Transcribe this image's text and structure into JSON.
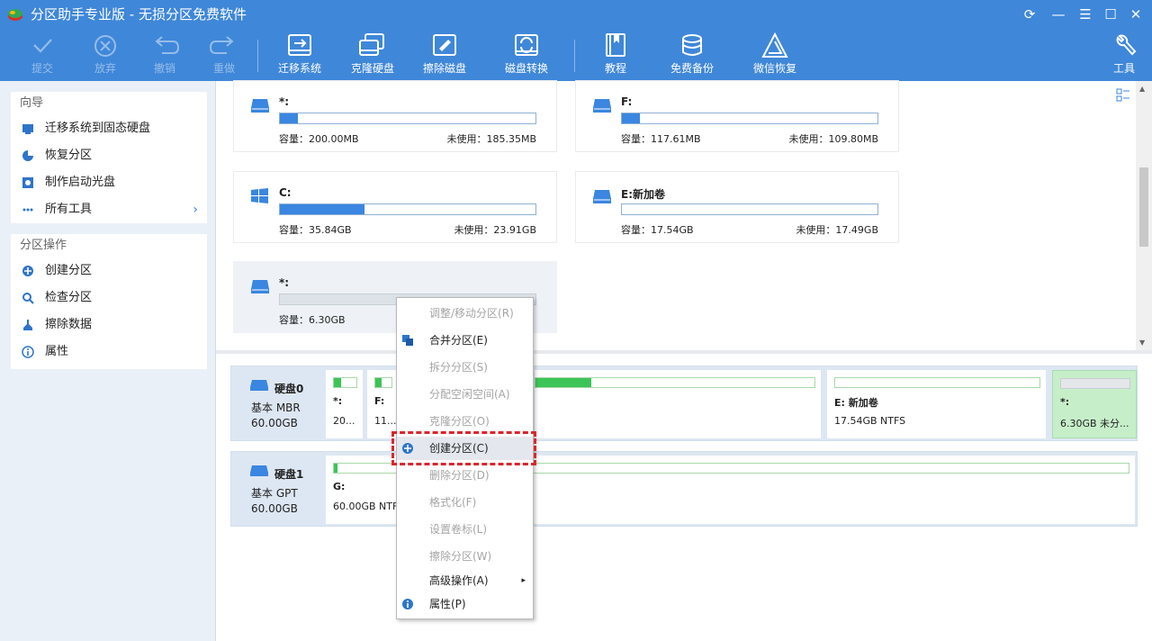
{
  "window": {
    "title": "分区助手专业版 - 无损分区免费软件",
    "controls": [
      "refresh-icon",
      "minimize-icon",
      "menu-icon",
      "maximize-icon",
      "close-icon"
    ]
  },
  "toolbar": {
    "buttons": [
      {
        "label": "提交",
        "icon": "check-icon",
        "enabled": false
      },
      {
        "label": "放弃",
        "icon": "cancel-icon",
        "enabled": false
      },
      {
        "label": "撤销",
        "icon": "undo-icon",
        "enabled": false
      },
      {
        "label": "重做",
        "icon": "redo-icon",
        "enabled": false
      },
      {
        "label": "迁移系统",
        "icon": "migrate-os-icon",
        "enabled": true
      },
      {
        "label": "克隆硬盘",
        "icon": "clone-disk-icon",
        "enabled": true
      },
      {
        "label": "擦除磁盘",
        "icon": "wipe-disk-icon",
        "enabled": true
      },
      {
        "label": "磁盘转换",
        "icon": "convert-disk-icon",
        "enabled": true
      },
      {
        "label": "教程",
        "icon": "tutorial-book-icon",
        "enabled": true
      },
      {
        "label": "免费备份",
        "icon": "backup-icon",
        "enabled": true
      },
      {
        "label": "微信恢复",
        "icon": "recovery-icon",
        "enabled": true
      },
      {
        "label": "工具",
        "icon": "tools-wrench-icon",
        "enabled": true
      }
    ]
  },
  "sidebar": {
    "wizard": {
      "title": "向导",
      "items": [
        {
          "label": "迁移系统到固态硬盘",
          "icon": "migrate-ssd-icon"
        },
        {
          "label": "恢复分区",
          "icon": "recover-partition-icon"
        },
        {
          "label": "制作启动光盘",
          "icon": "boot-disc-icon"
        },
        {
          "label": "所有工具",
          "icon": "all-tools-icon",
          "chevron": "›"
        }
      ]
    },
    "operations": {
      "title": "分区操作",
      "items": [
        {
          "label": "创建分区",
          "icon": "create-partition-icon"
        },
        {
          "label": "检查分区",
          "icon": "check-partition-icon"
        },
        {
          "label": "擦除数据",
          "icon": "wipe-data-icon"
        },
        {
          "label": "属性",
          "icon": "info-icon"
        }
      ]
    }
  },
  "partitions": [
    {
      "name": "*:",
      "capacity": "容量：200.00MB",
      "free": "未使用：185.35MB",
      "used_fraction": 0.07,
      "icon": "drive-icon"
    },
    {
      "name": "F:",
      "capacity": "容量：117.61MB",
      "free": "未使用：109.80MB",
      "used_fraction": 0.07,
      "icon": "drive-icon"
    },
    {
      "name": "C:",
      "capacity": "容量：35.84GB",
      "free": "未使用：23.91GB",
      "used_fraction": 0.33,
      "icon": "windows-icon"
    },
    {
      "name": "E:新加卷",
      "capacity": "容量：17.54GB",
      "free": "未使用：17.49GB",
      "used_fraction": 0.0,
      "icon": "drive-icon"
    },
    {
      "name": "*:",
      "capacity": "容量：6.30GB",
      "free": "",
      "used_fraction": 0,
      "icon": "drive-icon",
      "unallocated": true
    }
  ],
  "disks": [
    {
      "name": "硬盘0",
      "type": "基本 MBR",
      "size": "60.00GB",
      "parts": [
        {
          "name": "*:",
          "size": "20...",
          "used_fraction": 0.3
        },
        {
          "name": "F:",
          "size": "11...",
          "used_fraction": 0.4
        },
        {
          "name": "",
          "size": "",
          "used_fraction": 0.2
        },
        {
          "name": "E: 新加卷",
          "size": "17.54GB NTFS",
          "used_fraction": 0.0
        },
        {
          "name": "*:",
          "size": "6.30GB 未分...",
          "used_fraction": 0,
          "unallocated": true
        }
      ]
    },
    {
      "name": "硬盘1",
      "type": "基本 GPT",
      "size": "60.00GB",
      "parts": [
        {
          "name": "G:",
          "size": "60.00GB NTFS",
          "used_fraction": 0.005
        }
      ]
    }
  ],
  "context_menu": {
    "items": [
      {
        "label": "调整/移动分区(R)",
        "enabled": false
      },
      {
        "label": "合并分区(E)",
        "enabled": true,
        "icon": "merge-icon"
      },
      {
        "label": "拆分分区(S)",
        "enabled": false
      },
      {
        "label": "分配空闲空间(A)",
        "enabled": false
      },
      {
        "label": "克隆分区(O)",
        "enabled": false
      },
      {
        "label": "创建分区(C)",
        "enabled": true,
        "icon": "create-partition-icon",
        "highlighted": true
      },
      {
        "label": "删除分区(D)",
        "enabled": false
      },
      {
        "label": "格式化(F)",
        "enabled": false
      },
      {
        "label": "设置卷标(L)",
        "enabled": false
      },
      {
        "label": "擦除分区(W)",
        "enabled": false
      },
      {
        "label": "高级操作(A)",
        "enabled": true,
        "submenu": "▸"
      },
      {
        "label": "属性(P)",
        "enabled": true,
        "icon": "info-icon"
      }
    ]
  },
  "colors": {
    "titlebar": "#3f87d9",
    "usage_bar": "#3a86e0",
    "disk_used": "#3dc457",
    "highlight": "#d9262e"
  }
}
